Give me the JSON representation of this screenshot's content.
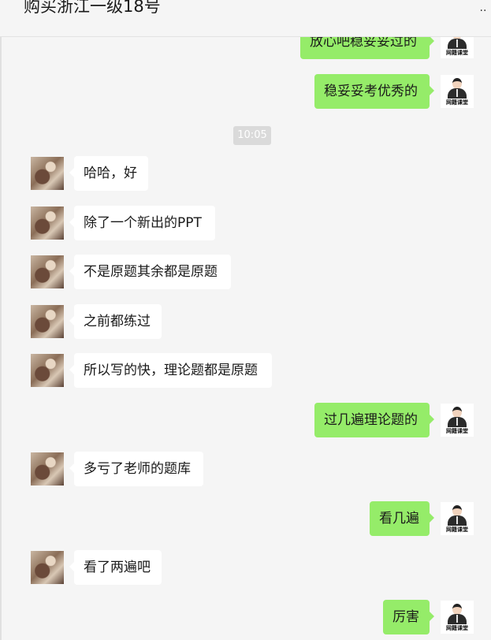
{
  "header": {
    "title": "购买浙江一级18号"
  },
  "avatars": {
    "teacher_brand": "网籍课堂"
  },
  "timestamp": "10:05",
  "messages": [
    {
      "side": "right",
      "text": "放心吧稳妥妥过的"
    },
    {
      "side": "right",
      "text": "稳妥妥考优秀的"
    },
    {
      "side": "left",
      "text": "哈哈，好"
    },
    {
      "side": "left",
      "text": "除了一个新出的PPT"
    },
    {
      "side": "left",
      "text": "不是原题其余都是原题"
    },
    {
      "side": "left",
      "text": "之前都练过"
    },
    {
      "side": "left",
      "text": "所以写的快，理论题都是原题"
    },
    {
      "side": "right",
      "text": "过几遍理论题的"
    },
    {
      "side": "left",
      "text": "多亏了老师的题库"
    },
    {
      "side": "right",
      "text": "看几遍"
    },
    {
      "side": "left",
      "text": "看了两遍吧"
    },
    {
      "side": "right",
      "text": "厉害"
    }
  ]
}
